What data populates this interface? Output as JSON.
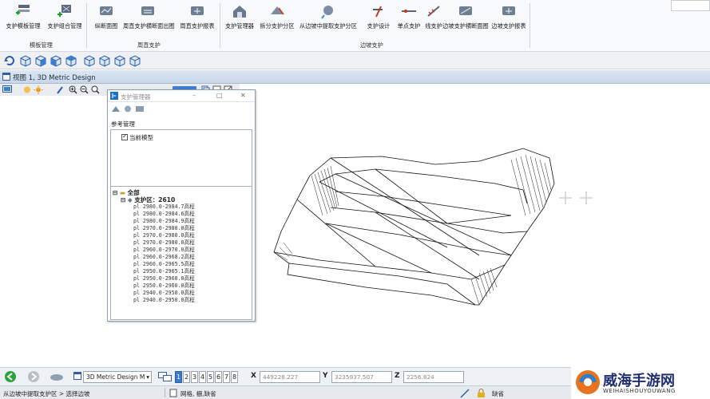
{
  "ribbon": {
    "buttons": [
      {
        "label": "支护模板管理"
      },
      {
        "label": "支护组合管理"
      },
      {
        "label": "纵断面图"
      },
      {
        "label": "周直支护横断面出图"
      },
      {
        "label": "周直支护报表"
      },
      {
        "label": "支护管理器"
      },
      {
        "label": "拆分支护分区"
      },
      {
        "label": "从边坡中提取支护分区"
      },
      {
        "label": "支护设计"
      },
      {
        "label": "单点支护"
      },
      {
        "label": "线支护"
      },
      {
        "label": "边坡支护横断面图"
      },
      {
        "label": "边坡支护报表"
      }
    ],
    "groups": [
      "模板管理",
      "周直支护",
      "边坡支护"
    ]
  },
  "view": {
    "title": "视图 1, 3D Metric Design"
  },
  "support_manager": {
    "title": "支护管理器",
    "ref_label": "参考管理",
    "ref_item": "当前模型",
    "tree_root": "全部",
    "area": "支护区：2610",
    "items": [
      "pl 2980.0-2984.7高程",
      "pl 2980.0-2984.6高程",
      "pl 2980.0-2984.9高程",
      "pl 2970.0-2980.0高程",
      "pl 2970.0-2980.0高程",
      "pl 2970.0-2980.0高程",
      "pl 2960.0-2970.0高程",
      "pl 2960.0-2968.2高程",
      "pl 2960.0-2965.5高程",
      "pl 2950.0-2965.1高程",
      "pl 2950.0-2960.0高程",
      "pl 2950.0-2960.0高程",
      "pl 2940.0-2950.0高程",
      "pl 2940.0-2950.0高程"
    ]
  },
  "status": {
    "view_select": "3D Metric Design M",
    "view_numbers": [
      "1",
      "2",
      "3",
      "4",
      "5",
      "6",
      "7",
      "8"
    ],
    "x_label": "X",
    "x_value": "449228.227",
    "y_label": "Y",
    "y_value": "3235937.507",
    "z_label": "Z",
    "z_value": "2256.824",
    "prompt": "从边坡中提取支护区 > 选择边坡",
    "snap": "网格, 栅,缺省",
    "level": "缺省"
  },
  "watermark": {
    "title": "威海手游网",
    "subtitle": "WEIHAISHOUYOUWANG"
  }
}
